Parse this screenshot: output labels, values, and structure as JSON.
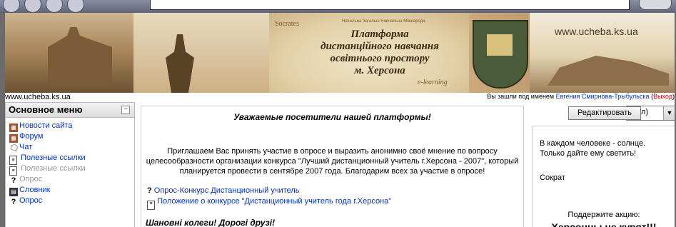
{
  "banner": {
    "socrates": "Socrates",
    "nav_links": "Начальна  Загальні  Навчальна  Міжнародн.",
    "title_lines": [
      "Платформа",
      "дистанційного навчання",
      "освітнього простору",
      "м. Херсона"
    ],
    "elearning": "e-learning",
    "site_url": "www.ucheba.ks.ua"
  },
  "url_line": "www.ucheba.ks.ua",
  "login": {
    "prefix": "Вы зашли под именем ",
    "user": "Евгения Смирнова-Трыбульска",
    "open_paren": " (",
    "exit": "Выход",
    "close_paren": ")"
  },
  "sidebar": {
    "title": "Основное меню",
    "collapse_symbol": "−",
    "items": [
      {
        "icon": "news-icon",
        "label": "Новости сайта",
        "dim": false
      },
      {
        "icon": "forum-icon",
        "label": "Форум",
        "dim": false
      },
      {
        "icon": "chat-icon",
        "label": "Чат",
        "dim": false
      },
      {
        "icon": "document-icon",
        "label": "Полезные ссылки",
        "dim": false
      },
      {
        "icon": "document-icon",
        "label": "Полезные ссылки",
        "dim": true
      },
      {
        "icon": "question-icon",
        "label": "Опрос",
        "dim": true
      },
      {
        "icon": "dictionary-icon",
        "label": "Словник",
        "dim": false
      },
      {
        "icon": "question-icon",
        "label": "Опрос",
        "dim": false
      }
    ]
  },
  "center": {
    "heading": "Уважаемые посетители нашей платформы!",
    "paragraph": "Приглашаем Вас принять участие в опросе и выразить анонимно своё мнение по вопросу целесообразности организации конкурса \"Лучший дистанционный учитель г.Херсона - 2007\", который планируется провести в сентябре 2007 года. Благодарим всех за участие в опросе!",
    "link1": "Опрос-Конкурс Дистанционный учитель",
    "link2": "Положение о конкурсе \"Дистанционный учитель года г.Херсона\"",
    "subheading": "Шановні колеги! Дорогі друзі!"
  },
  "edit_button": "Редактировать",
  "select_value": "л)",
  "right": {
    "quote": "В каждом человеке - солнце. Только дайте ему светить!",
    "author": "Сократ",
    "support": "Поддержите акцию:",
    "slogan": "Херсонцы не курят!!!"
  }
}
